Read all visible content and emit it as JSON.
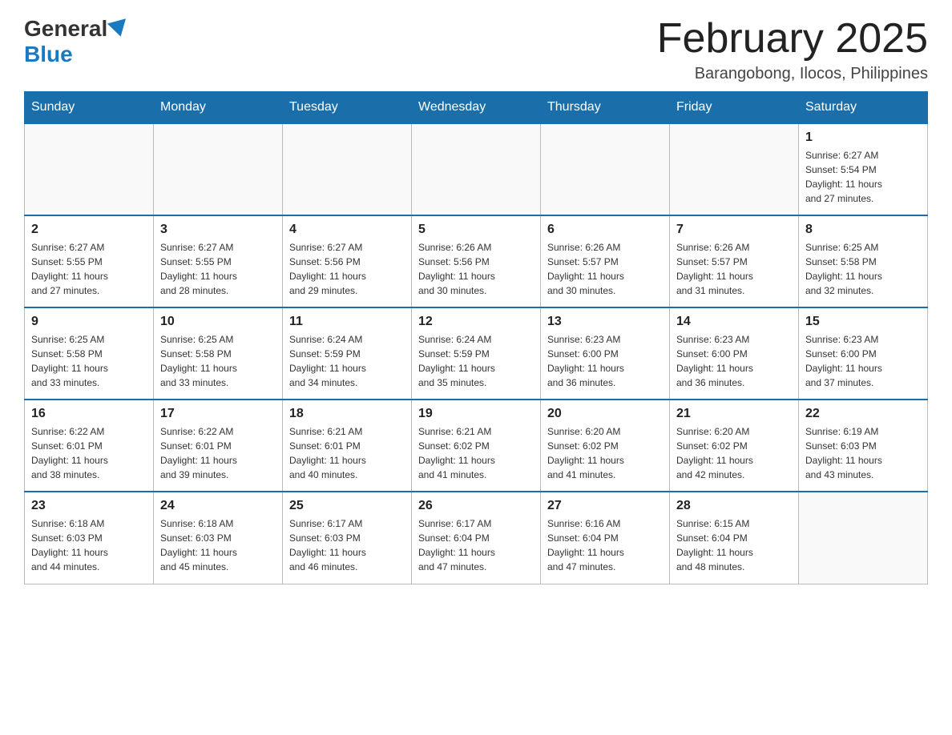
{
  "header": {
    "logo_general": "General",
    "logo_blue": "Blue",
    "title": "February 2025",
    "location": "Barangobong, Ilocos, Philippines"
  },
  "weekdays": [
    "Sunday",
    "Monday",
    "Tuesday",
    "Wednesday",
    "Thursday",
    "Friday",
    "Saturday"
  ],
  "weeks": [
    [
      {
        "day": "",
        "info": ""
      },
      {
        "day": "",
        "info": ""
      },
      {
        "day": "",
        "info": ""
      },
      {
        "day": "",
        "info": ""
      },
      {
        "day": "",
        "info": ""
      },
      {
        "day": "",
        "info": ""
      },
      {
        "day": "1",
        "info": "Sunrise: 6:27 AM\nSunset: 5:54 PM\nDaylight: 11 hours\nand 27 minutes."
      }
    ],
    [
      {
        "day": "2",
        "info": "Sunrise: 6:27 AM\nSunset: 5:55 PM\nDaylight: 11 hours\nand 27 minutes."
      },
      {
        "day": "3",
        "info": "Sunrise: 6:27 AM\nSunset: 5:55 PM\nDaylight: 11 hours\nand 28 minutes."
      },
      {
        "day": "4",
        "info": "Sunrise: 6:27 AM\nSunset: 5:56 PM\nDaylight: 11 hours\nand 29 minutes."
      },
      {
        "day": "5",
        "info": "Sunrise: 6:26 AM\nSunset: 5:56 PM\nDaylight: 11 hours\nand 30 minutes."
      },
      {
        "day": "6",
        "info": "Sunrise: 6:26 AM\nSunset: 5:57 PM\nDaylight: 11 hours\nand 30 minutes."
      },
      {
        "day": "7",
        "info": "Sunrise: 6:26 AM\nSunset: 5:57 PM\nDaylight: 11 hours\nand 31 minutes."
      },
      {
        "day": "8",
        "info": "Sunrise: 6:25 AM\nSunset: 5:58 PM\nDaylight: 11 hours\nand 32 minutes."
      }
    ],
    [
      {
        "day": "9",
        "info": "Sunrise: 6:25 AM\nSunset: 5:58 PM\nDaylight: 11 hours\nand 33 minutes."
      },
      {
        "day": "10",
        "info": "Sunrise: 6:25 AM\nSunset: 5:58 PM\nDaylight: 11 hours\nand 33 minutes."
      },
      {
        "day": "11",
        "info": "Sunrise: 6:24 AM\nSunset: 5:59 PM\nDaylight: 11 hours\nand 34 minutes."
      },
      {
        "day": "12",
        "info": "Sunrise: 6:24 AM\nSunset: 5:59 PM\nDaylight: 11 hours\nand 35 minutes."
      },
      {
        "day": "13",
        "info": "Sunrise: 6:23 AM\nSunset: 6:00 PM\nDaylight: 11 hours\nand 36 minutes."
      },
      {
        "day": "14",
        "info": "Sunrise: 6:23 AM\nSunset: 6:00 PM\nDaylight: 11 hours\nand 36 minutes."
      },
      {
        "day": "15",
        "info": "Sunrise: 6:23 AM\nSunset: 6:00 PM\nDaylight: 11 hours\nand 37 minutes."
      }
    ],
    [
      {
        "day": "16",
        "info": "Sunrise: 6:22 AM\nSunset: 6:01 PM\nDaylight: 11 hours\nand 38 minutes."
      },
      {
        "day": "17",
        "info": "Sunrise: 6:22 AM\nSunset: 6:01 PM\nDaylight: 11 hours\nand 39 minutes."
      },
      {
        "day": "18",
        "info": "Sunrise: 6:21 AM\nSunset: 6:01 PM\nDaylight: 11 hours\nand 40 minutes."
      },
      {
        "day": "19",
        "info": "Sunrise: 6:21 AM\nSunset: 6:02 PM\nDaylight: 11 hours\nand 41 minutes."
      },
      {
        "day": "20",
        "info": "Sunrise: 6:20 AM\nSunset: 6:02 PM\nDaylight: 11 hours\nand 41 minutes."
      },
      {
        "day": "21",
        "info": "Sunrise: 6:20 AM\nSunset: 6:02 PM\nDaylight: 11 hours\nand 42 minutes."
      },
      {
        "day": "22",
        "info": "Sunrise: 6:19 AM\nSunset: 6:03 PM\nDaylight: 11 hours\nand 43 minutes."
      }
    ],
    [
      {
        "day": "23",
        "info": "Sunrise: 6:18 AM\nSunset: 6:03 PM\nDaylight: 11 hours\nand 44 minutes."
      },
      {
        "day": "24",
        "info": "Sunrise: 6:18 AM\nSunset: 6:03 PM\nDaylight: 11 hours\nand 45 minutes."
      },
      {
        "day": "25",
        "info": "Sunrise: 6:17 AM\nSunset: 6:03 PM\nDaylight: 11 hours\nand 46 minutes."
      },
      {
        "day": "26",
        "info": "Sunrise: 6:17 AM\nSunset: 6:04 PM\nDaylight: 11 hours\nand 47 minutes."
      },
      {
        "day": "27",
        "info": "Sunrise: 6:16 AM\nSunset: 6:04 PM\nDaylight: 11 hours\nand 47 minutes."
      },
      {
        "day": "28",
        "info": "Sunrise: 6:15 AM\nSunset: 6:04 PM\nDaylight: 11 hours\nand 48 minutes."
      },
      {
        "day": "",
        "info": ""
      }
    ]
  ]
}
